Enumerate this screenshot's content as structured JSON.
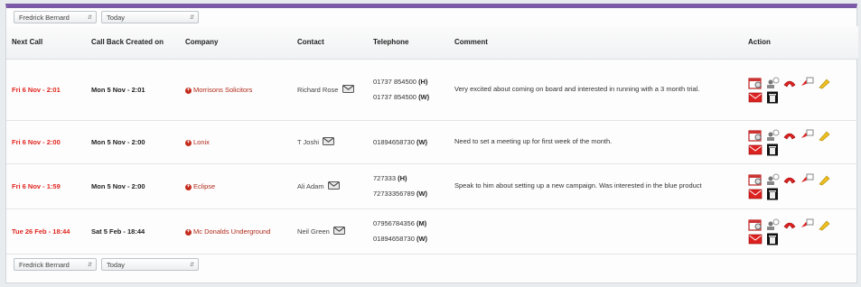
{
  "filters": {
    "user": "Fredrick Bernard",
    "period": "Today"
  },
  "columns": {
    "next_call": "Next Call",
    "call_back_created": "Call Back Created on",
    "company": "Company",
    "contact": "Contact",
    "telephone": "Telephone",
    "comment": "Comment",
    "action": "Action"
  },
  "rows": [
    {
      "next_call": "Fri 6 Nov - 2:01",
      "created": "Mon 5 Nov - 2:01",
      "company": "Morrisons Solicitors",
      "contact": "Richard Rose",
      "phones": [
        {
          "number": "01737 854500",
          "type": "(H)"
        },
        {
          "number": "01737 854500",
          "type": "(W)"
        }
      ],
      "comment": "Very excited about coming on board and interested in running with a 3 month trial."
    },
    {
      "next_call": "Fri 6 Nov - 2:00",
      "created": "Mon 5 Nov - 2:00",
      "company": "Lonix",
      "contact": "T Joshi",
      "phones": [
        {
          "number": "01894658730",
          "type": "(W)"
        }
      ],
      "comment": "Need to set a meeting up for first week of the month."
    },
    {
      "next_call": "Fri 6 Nov - 1:59",
      "created": "Mon 5 Nov - 2:00",
      "company": "Eclipse",
      "contact": "Ali Adam",
      "phones": [
        {
          "number": "727333",
          "type": "(H)"
        },
        {
          "number": "72733356789",
          "type": "(W)"
        }
      ],
      "comment": "Speak to him about setting up a new campaign. Was interested in the blue product"
    },
    {
      "next_call": "Tue 26 Feb - 18:44",
      "created": "Sat 5 Feb - 18:44",
      "company": "Mc Donalds Underground",
      "contact": "Neil Green",
      "phones": [
        {
          "number": "07956784356",
          "type": "(M)"
        },
        {
          "number": "01894658730",
          "type": "(W)"
        }
      ],
      "comment": ""
    }
  ],
  "icons": {
    "actions": [
      "calendar-icon",
      "users-icon",
      "phone-icon",
      "phone-dial-icon",
      "pencil-icon",
      "email-icon",
      "delete-icon"
    ],
    "company": "plus-icon",
    "contact": "envelope-icon"
  },
  "colors": {
    "accent_bar": "#7b5aa6",
    "next_call": "#e2261f",
    "company": "#b02a1a"
  }
}
